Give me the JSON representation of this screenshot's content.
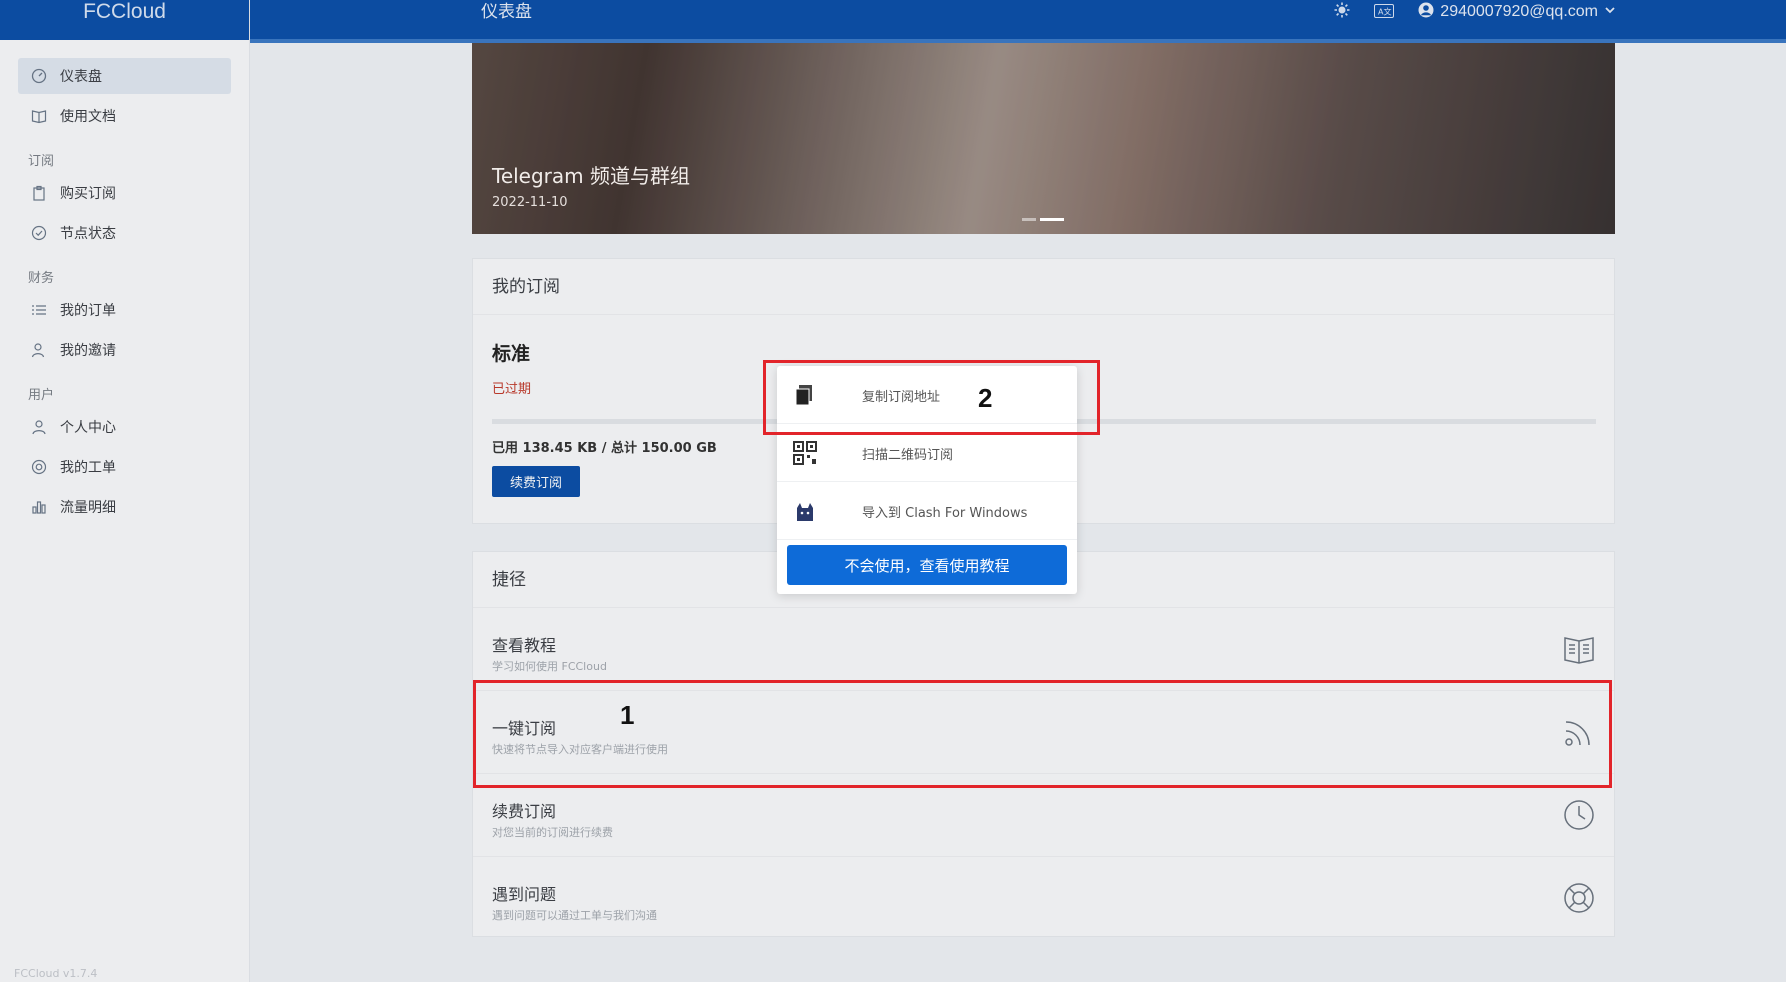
{
  "brand": "FCCloud",
  "header": {
    "page_title": "仪表盘",
    "user_email": "2940007920@qq.com",
    "theme_icon": "sun-gear-icon",
    "lang_icon": "translate-icon"
  },
  "sidebar": {
    "items_main": [
      {
        "label": "仪表盘",
        "icon": "dashboard-icon",
        "active": true
      },
      {
        "label": "使用文档",
        "icon": "book-icon"
      }
    ],
    "section_subscribe": "订阅",
    "items_subscribe": [
      {
        "label": "购买订阅",
        "icon": "clipboard-icon"
      },
      {
        "label": "节点状态",
        "icon": "check-circle-icon"
      }
    ],
    "section_finance": "财务",
    "items_finance": [
      {
        "label": "我的订单",
        "icon": "list-icon"
      },
      {
        "label": "我的邀请",
        "icon": "user-plus-icon"
      }
    ],
    "section_user": "用户",
    "items_user": [
      {
        "label": "个人中心",
        "icon": "user-icon"
      },
      {
        "label": "我的工单",
        "icon": "support-icon"
      },
      {
        "label": "流量明细",
        "icon": "bar-chart-icon"
      }
    ],
    "version": "FCCloud v1.7.4"
  },
  "banner": {
    "title": "Telegram 频道与群组",
    "date": "2022-11-10"
  },
  "subscription": {
    "heading": "我的订阅",
    "plan": "标准",
    "status": "已过期",
    "usage": "已用 138.45 KB / 总计 150.00 GB",
    "usage_fraction": 1e-06,
    "renew_label": "续费订阅"
  },
  "shortcuts": {
    "heading": "捷径",
    "items": [
      {
        "title": "查看教程",
        "desc": "学习如何使用 FCCloud",
        "icon": "book-icon"
      },
      {
        "title": "一键订阅",
        "desc": "快速将节点导入对应客户端进行使用",
        "icon": "rss-icon"
      },
      {
        "title": "续费订阅",
        "desc": "对您当前的订阅进行续费",
        "icon": "clock-icon"
      },
      {
        "title": "遇到问题",
        "desc": "遇到问题可以通过工单与我们沟通",
        "icon": "lifebuoy-icon"
      }
    ]
  },
  "popup": {
    "items": [
      {
        "label": "复制订阅地址",
        "icon": "copy-icon"
      },
      {
        "label": "扫描二维码订阅",
        "icon": "qrcode-icon"
      },
      {
        "label": "导入到 Clash For Windows",
        "icon": "cat-icon"
      }
    ],
    "button": "不会使用，查看使用教程"
  },
  "annotations": {
    "label_1": "1",
    "label_2": "2",
    "color": "#e2242a"
  }
}
